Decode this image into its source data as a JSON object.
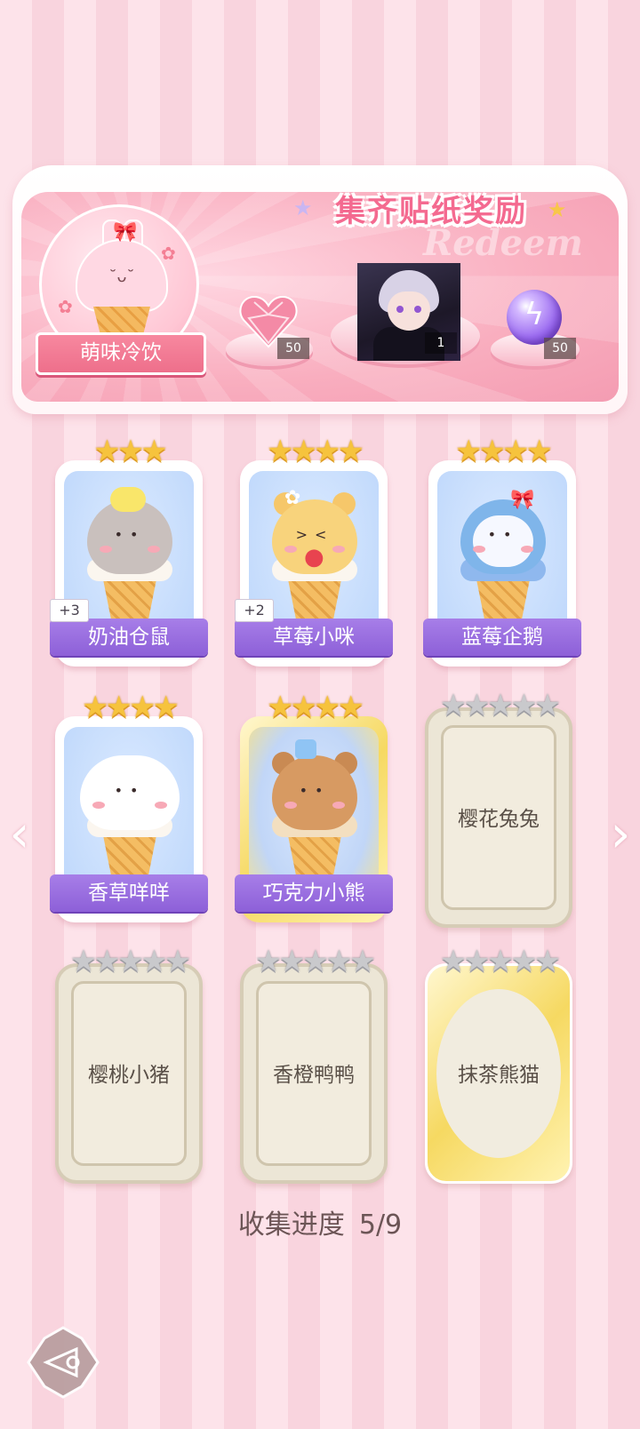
{
  "banner": {
    "title": "集齐贴纸奖励",
    "deco_text": "Redeem",
    "collection_name": "萌味冷饮",
    "rewards": [
      {
        "name": "heart-gem-icon",
        "qty": "50"
      },
      {
        "name": "character-portrait",
        "qty": "1"
      },
      {
        "name": "energy-orb-icon",
        "qty": "50"
      }
    ]
  },
  "stickers": [
    {
      "label": "奶油仓鼠",
      "dup": "+3",
      "stars": "★★★",
      "collected": true
    },
    {
      "label": "草莓小咪",
      "dup": "+2",
      "stars": "★★★★",
      "collected": true
    },
    {
      "label": "蓝莓企鹅",
      "dup": "",
      "stars": "★★★★",
      "collected": true
    },
    {
      "label": "香草咩咩",
      "dup": "",
      "stars": "★★★★",
      "collected": true
    },
    {
      "label": "巧克力小熊",
      "dup": "",
      "stars": "★★★★",
      "collected": true
    },
    {
      "label": "樱花兔兔",
      "dup": "",
      "stars": "★★★★★",
      "collected": false
    },
    {
      "label": "樱桃小猪",
      "dup": "",
      "stars": "★★★★★",
      "collected": false
    },
    {
      "label": "香橙鸭鸭",
      "dup": "",
      "stars": "★★★★★",
      "collected": false
    },
    {
      "label": "抹茶熊猫",
      "dup": "",
      "stars": "★★★★★",
      "collected": false
    }
  ],
  "progress": {
    "label": "收集进度",
    "value": "5/9"
  },
  "nav": {
    "prev": "‹",
    "next": "›"
  },
  "colors": {
    "accent_pink": "#f46a90",
    "label_purple": "#8d60d8",
    "star_gold": "#f6c33d"
  }
}
